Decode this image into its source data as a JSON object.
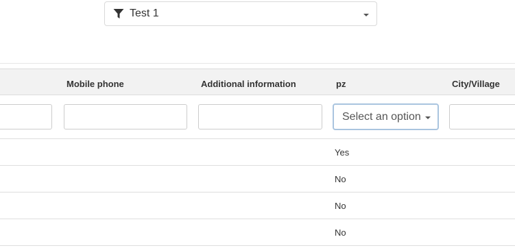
{
  "filter": {
    "icon": "filter-icon",
    "label": "Test 1"
  },
  "table": {
    "columns": [
      "Mobile phone",
      "Additional information",
      "pz",
      "City/Village"
    ],
    "pz_filter_placeholder": "Select an option",
    "rows": [
      {
        "pz": "Yes"
      },
      {
        "pz": "No"
      },
      {
        "pz": "No"
      },
      {
        "pz": "No"
      }
    ]
  },
  "colors": {
    "header_bg": "#f2f2f2",
    "focus_border": "#a9c4df",
    "border": "#cccccc"
  }
}
